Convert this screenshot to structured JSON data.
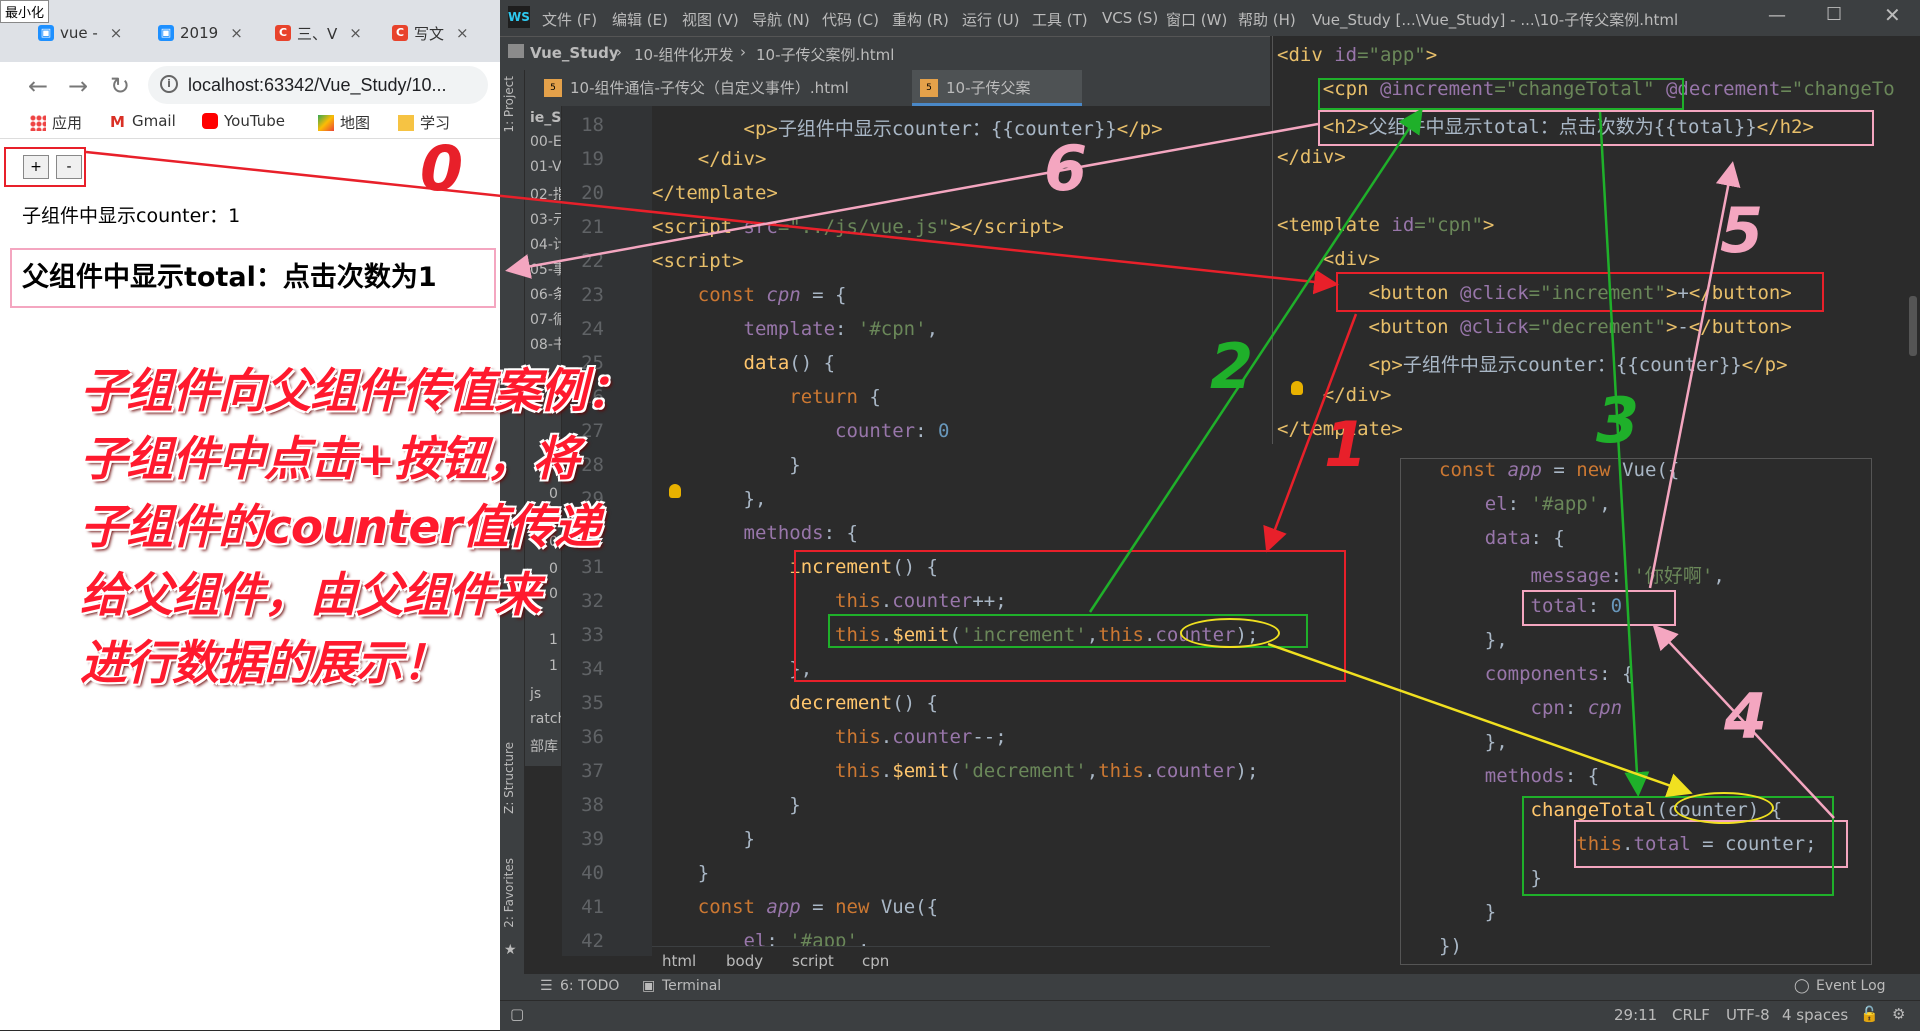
{
  "browser": {
    "minimize_tip": "最小化",
    "tabs": [
      {
        "label": "vue -",
        "close": "×",
        "color": "#1e90ff"
      },
      {
        "label": "2019",
        "close": "×",
        "color": "#1e90ff"
      },
      {
        "label": "三、V",
        "close": "×",
        "color": "#e8432c"
      },
      {
        "label": "写文",
        "close": "×",
        "color": "#e8432c"
      }
    ],
    "url": "localhost:63342/Vue_Study/10...",
    "bookmarks": [
      "应用",
      "Gmail",
      "YouTube",
      "地图",
      "学习"
    ],
    "page": {
      "plus_label": "+",
      "minus_label": "-",
      "child_counter": "子组件中显示counter：1",
      "parent_total": "父组件中显示total：点击次数为1"
    },
    "caption_lines": [
      "子组件向父组件传值案例：",
      "子组件中点击+按钮，将",
      "子组件的counter值传递",
      "给父组件，由父组件来",
      "进行数据的展示！"
    ]
  },
  "ide": {
    "menu": [
      "文件 (F)",
      "编辑 (E)",
      "视图 (V)",
      "导航 (N)",
      "代码 (C)",
      "重构 (R)",
      "运行 (U)",
      "工具 (T)",
      "VCS (S)",
      "窗口 (W)",
      "帮助 (H)"
    ],
    "window_title": "Vue_Study [...\\Vue_Study] - ...\\10-子传父案例.html",
    "breadcrumb": [
      "Vue_Study",
      "10-组件化开发",
      "10-子传父案例.html"
    ],
    "tabs": [
      {
        "label": "10-组件通信-子传父（自定义事件）.html",
        "active": false
      },
      {
        "label": "10-子传父案例.html",
        "active": true
      }
    ],
    "side_labels": [
      "1: Project",
      "Z: Structure",
      "2: Favorites"
    ],
    "project_items": [
      "ie_Stu",
      "00-E",
      "01-V",
      "02-指",
      "03-元",
      "04-计",
      "05-事",
      "06-条",
      "07-循",
      "08-书",
      "0",
      "0",
      "0",
      "0",
      "1",
      "1",
      "js",
      "ratch",
      "部库"
    ],
    "line_numbers": [
      "18",
      "19",
      "20",
      "21",
      "22",
      "23",
      "24",
      "25",
      "26",
      "27",
      "28",
      "29",
      "30",
      "31",
      "32",
      "33",
      "34",
      "35",
      "36",
      "37",
      "38",
      "39",
      "40",
      "41",
      "42"
    ],
    "edit_crumb": [
      "html",
      "body",
      "script",
      "cpn"
    ],
    "bottom_tools": [
      "6: TODO",
      "Terminal",
      "Event Log"
    ],
    "status": {
      "position": "29:11",
      "line_sep": "CRLF",
      "encoding": "UTF-8",
      "indent": "4 spaces"
    }
  },
  "annotations": {
    "numbers": [
      "0",
      "1",
      "2",
      "3",
      "4",
      "5",
      "6"
    ],
    "colors": {
      "red": "#e8202a",
      "green": "#1fb02a",
      "pink": "#f4a6c0",
      "yellow": "#f0e020"
    }
  }
}
